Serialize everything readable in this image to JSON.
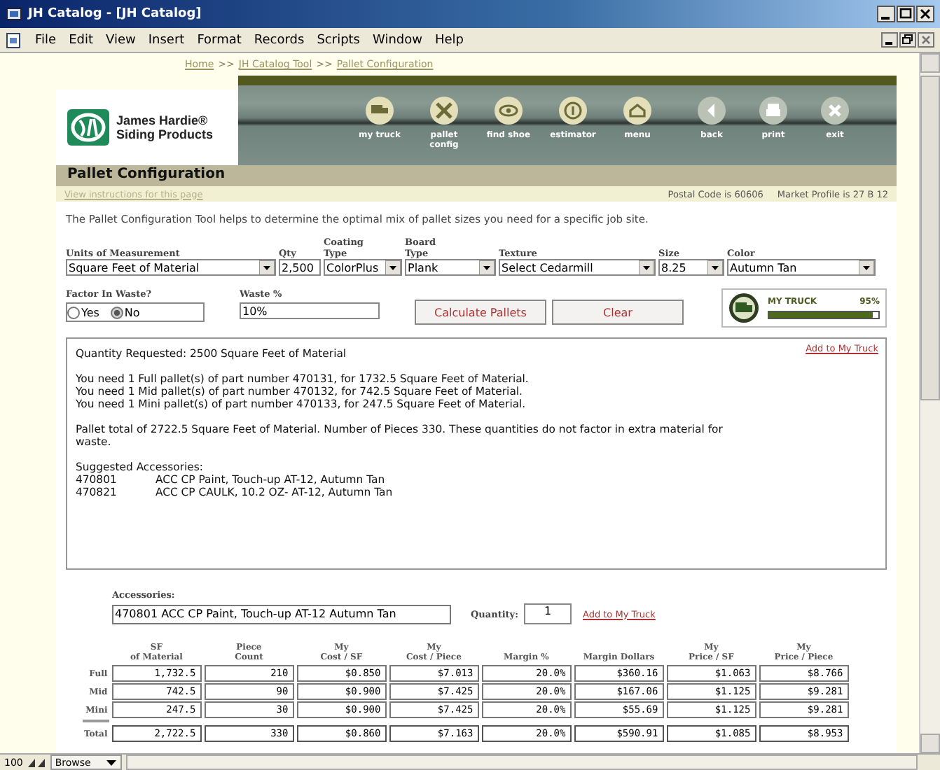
{
  "window": {
    "title": "JH Catalog - [JH Catalog]"
  },
  "menu": [
    "File",
    "Edit",
    "View",
    "Insert",
    "Format",
    "Records",
    "Scripts",
    "Window",
    "Help"
  ],
  "breadcrumb": {
    "links": [
      "Home",
      "JH Catalog Tool",
      "Pallet Configuration"
    ],
    "separator": ">>"
  },
  "logo": {
    "name": "James Hardie®",
    "tagline": "Siding Products"
  },
  "nav": [
    {
      "label": "my truck",
      "kind": "truck"
    },
    {
      "label": "pallet config",
      "kind": "tools"
    },
    {
      "label": "find shoe",
      "kind": "eye"
    },
    {
      "label": "estimator",
      "kind": "info"
    },
    {
      "label": "menu",
      "kind": "house"
    },
    {
      "label": "back",
      "kind": "back"
    },
    {
      "label": "print",
      "kind": "print"
    },
    {
      "label": "exit",
      "kind": "exit"
    }
  ],
  "page": {
    "title": "Pallet Configuration",
    "instructions_link": "View instructions for this page",
    "postal_code": "Postal Code is 60606",
    "market_profile": "Market Profile is 27 B 12",
    "description": "The Pallet Configuration Tool helps to determine the optimal mix of pallet sizes you need for a specific job site."
  },
  "form": [
    {
      "label": "Units of Measurement",
      "kind": "select",
      "value": "Square Feet of Material"
    },
    {
      "label": "Qty",
      "kind": "input",
      "value": "2,500"
    },
    {
      "label": "Coating Type",
      "kind": "select",
      "value": "ColorPlus"
    },
    {
      "label": "Board Type",
      "kind": "select",
      "value": "Plank"
    },
    {
      "label": "Texture",
      "kind": "select",
      "value": "Select Cedarmill"
    },
    {
      "label": "Size",
      "kind": "select",
      "value": "8.25"
    },
    {
      "label": "Color",
      "kind": "select",
      "value": "Autumn Tan"
    }
  ],
  "waste": {
    "label": "Factor In Waste?",
    "options": [
      {
        "label": "Yes",
        "selected": false
      },
      {
        "label": "No",
        "selected": true
      }
    ],
    "percent_label": "Waste %",
    "percent_value": "10%"
  },
  "buttons": [
    "Calculate Pallets",
    "Clear"
  ],
  "truck": {
    "label": "MY TRUCK",
    "reading": "95%",
    "level": 0.95
  },
  "results": {
    "link": "Add to My Truck",
    "groups": [
      [
        "Quantity Requested: 2500 Square Feet of Material"
      ],
      [
        "You need 1 Full pallet(s) of part number 470131, for 1732.5 Square Feet of Material.",
        "You need 1 Mid pallet(s) of part number 470132, for 742.5 Square Feet of Material.",
        "You need 1 Mini pallet(s) of part number 470133, for 247.5 Square Feet of Material."
      ],
      [
        "Pallet total of 2722.5 Square Feet of Material. Number of Pieces 330. These quantities do not factor in extra material for waste."
      ],
      [
        "Suggested Accessories:"
      ]
    ],
    "accessories": [
      {
        "code": "470801",
        "description": "ACC CP Paint, Touch-up AT-12, Autumn Tan"
      },
      {
        "code": "470821",
        "description": "ACC CP CAULK, 10.2 OZ- AT-12, Autumn Tan"
      }
    ]
  },
  "accessory_form": {
    "label": "Accessories:",
    "value": "470801 ACC CP Paint, Touch-up AT-12 Autumn Tan",
    "quantity_label": "Quantity:",
    "quantity": "1",
    "link": "Add to My Truck"
  },
  "table": {
    "columns": [
      "SF\nof Material",
      "Piece\nCount",
      "My\nCost / SF",
      "My\nCost / Piece",
      "Margin %",
      "Margin Dollars",
      "My\nPrice / SF",
      "My\nPrice / Piece"
    ],
    "rows": [
      {
        "label": "Full",
        "kind": "item",
        "cells": [
          "1,732.5",
          "210",
          "$0.850",
          "$7.013",
          "20.0%",
          "$360.16",
          "$1.063",
          "$8.766"
        ]
      },
      {
        "label": "Mid",
        "kind": "item",
        "cells": [
          "742.5",
          "90",
          "$0.900",
          "$7.425",
          "20.0%",
          "$167.06",
          "$1.125",
          "$9.281"
        ]
      },
      {
        "label": "Mini",
        "kind": "item",
        "cells": [
          "247.5",
          "30",
          "$0.900",
          "$7.425",
          "20.0%",
          "$55.69",
          "$1.125",
          "$9.281"
        ]
      },
      {
        "label": "Total",
        "kind": "total",
        "cells": [
          "2,722.5",
          "330",
          "$0.860",
          "$7.163",
          "20.0%",
          "$590.91",
          "$1.085",
          "$8.953"
        ]
      }
    ]
  },
  "status_bar": {
    "zoom": "100",
    "mode": "Browse"
  }
}
